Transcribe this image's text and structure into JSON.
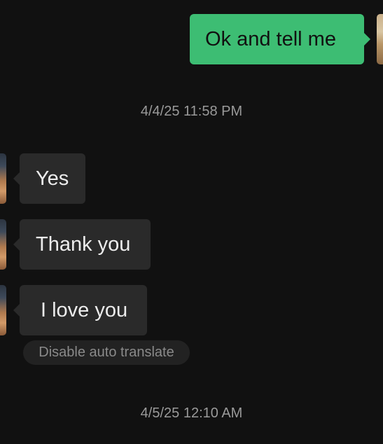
{
  "messages": {
    "outgoing_1": "Ok and tell me",
    "incoming_1": "Yes",
    "incoming_2": "Thank you",
    "incoming_3": "I love you"
  },
  "timestamps": {
    "first": "4/4/25 11:58 PM",
    "second": "4/5/25 12:10 AM"
  },
  "actions": {
    "disable_auto_translate": "Disable auto translate"
  },
  "colors": {
    "background": "#111111",
    "outgoing_bubble": "#3dbd73",
    "incoming_bubble": "#2a2a2a",
    "timestamp_text": "#9a9a9a"
  }
}
